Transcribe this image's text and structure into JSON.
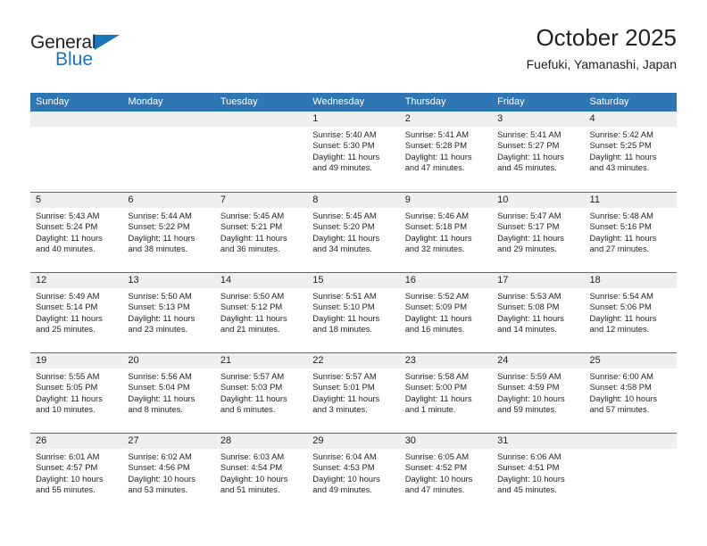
{
  "brand": {
    "name_part1": "General",
    "name_part2": "Blue",
    "accent_color": "#1b75bb"
  },
  "header": {
    "title": "October 2025",
    "location": "Fuefuki, Yamanashi, Japan"
  },
  "theme": {
    "header_row_bg": "#2f76b5",
    "day_band_bg": "#efefef",
    "grid_line": "#2f76b5",
    "text": "#231f20"
  },
  "weekday_headers": [
    "Sunday",
    "Monday",
    "Tuesday",
    "Wednesday",
    "Thursday",
    "Friday",
    "Saturday"
  ],
  "weeks": [
    [
      {
        "day": "",
        "blank": true,
        "sunrise": "",
        "sunset": "",
        "daylight_line1": "",
        "daylight_line2": ""
      },
      {
        "day": "",
        "blank": true,
        "sunrise": "",
        "sunset": "",
        "daylight_line1": "",
        "daylight_line2": ""
      },
      {
        "day": "",
        "blank": true,
        "sunrise": "",
        "sunset": "",
        "daylight_line1": "",
        "daylight_line2": ""
      },
      {
        "day": "1",
        "blank": false,
        "sunrise": "Sunrise: 5:40 AM",
        "sunset": "Sunset: 5:30 PM",
        "daylight_line1": "Daylight: 11 hours",
        "daylight_line2": "and 49 minutes."
      },
      {
        "day": "2",
        "blank": false,
        "sunrise": "Sunrise: 5:41 AM",
        "sunset": "Sunset: 5:28 PM",
        "daylight_line1": "Daylight: 11 hours",
        "daylight_line2": "and 47 minutes."
      },
      {
        "day": "3",
        "blank": false,
        "sunrise": "Sunrise: 5:41 AM",
        "sunset": "Sunset: 5:27 PM",
        "daylight_line1": "Daylight: 11 hours",
        "daylight_line2": "and 45 minutes."
      },
      {
        "day": "4",
        "blank": false,
        "sunrise": "Sunrise: 5:42 AM",
        "sunset": "Sunset: 5:25 PM",
        "daylight_line1": "Daylight: 11 hours",
        "daylight_line2": "and 43 minutes."
      }
    ],
    [
      {
        "day": "5",
        "blank": false,
        "sunrise": "Sunrise: 5:43 AM",
        "sunset": "Sunset: 5:24 PM",
        "daylight_line1": "Daylight: 11 hours",
        "daylight_line2": "and 40 minutes."
      },
      {
        "day": "6",
        "blank": false,
        "sunrise": "Sunrise: 5:44 AM",
        "sunset": "Sunset: 5:22 PM",
        "daylight_line1": "Daylight: 11 hours",
        "daylight_line2": "and 38 minutes."
      },
      {
        "day": "7",
        "blank": false,
        "sunrise": "Sunrise: 5:45 AM",
        "sunset": "Sunset: 5:21 PM",
        "daylight_line1": "Daylight: 11 hours",
        "daylight_line2": "and 36 minutes."
      },
      {
        "day": "8",
        "blank": false,
        "sunrise": "Sunrise: 5:45 AM",
        "sunset": "Sunset: 5:20 PM",
        "daylight_line1": "Daylight: 11 hours",
        "daylight_line2": "and 34 minutes."
      },
      {
        "day": "9",
        "blank": false,
        "sunrise": "Sunrise: 5:46 AM",
        "sunset": "Sunset: 5:18 PM",
        "daylight_line1": "Daylight: 11 hours",
        "daylight_line2": "and 32 minutes."
      },
      {
        "day": "10",
        "blank": false,
        "sunrise": "Sunrise: 5:47 AM",
        "sunset": "Sunset: 5:17 PM",
        "daylight_line1": "Daylight: 11 hours",
        "daylight_line2": "and 29 minutes."
      },
      {
        "day": "11",
        "blank": false,
        "sunrise": "Sunrise: 5:48 AM",
        "sunset": "Sunset: 5:16 PM",
        "daylight_line1": "Daylight: 11 hours",
        "daylight_line2": "and 27 minutes."
      }
    ],
    [
      {
        "day": "12",
        "blank": false,
        "sunrise": "Sunrise: 5:49 AM",
        "sunset": "Sunset: 5:14 PM",
        "daylight_line1": "Daylight: 11 hours",
        "daylight_line2": "and 25 minutes."
      },
      {
        "day": "13",
        "blank": false,
        "sunrise": "Sunrise: 5:50 AM",
        "sunset": "Sunset: 5:13 PM",
        "daylight_line1": "Daylight: 11 hours",
        "daylight_line2": "and 23 minutes."
      },
      {
        "day": "14",
        "blank": false,
        "sunrise": "Sunrise: 5:50 AM",
        "sunset": "Sunset: 5:12 PM",
        "daylight_line1": "Daylight: 11 hours",
        "daylight_line2": "and 21 minutes."
      },
      {
        "day": "15",
        "blank": false,
        "sunrise": "Sunrise: 5:51 AM",
        "sunset": "Sunset: 5:10 PM",
        "daylight_line1": "Daylight: 11 hours",
        "daylight_line2": "and 18 minutes."
      },
      {
        "day": "16",
        "blank": false,
        "sunrise": "Sunrise: 5:52 AM",
        "sunset": "Sunset: 5:09 PM",
        "daylight_line1": "Daylight: 11 hours",
        "daylight_line2": "and 16 minutes."
      },
      {
        "day": "17",
        "blank": false,
        "sunrise": "Sunrise: 5:53 AM",
        "sunset": "Sunset: 5:08 PM",
        "daylight_line1": "Daylight: 11 hours",
        "daylight_line2": "and 14 minutes."
      },
      {
        "day": "18",
        "blank": false,
        "sunrise": "Sunrise: 5:54 AM",
        "sunset": "Sunset: 5:06 PM",
        "daylight_line1": "Daylight: 11 hours",
        "daylight_line2": "and 12 minutes."
      }
    ],
    [
      {
        "day": "19",
        "blank": false,
        "sunrise": "Sunrise: 5:55 AM",
        "sunset": "Sunset: 5:05 PM",
        "daylight_line1": "Daylight: 11 hours",
        "daylight_line2": "and 10 minutes."
      },
      {
        "day": "20",
        "blank": false,
        "sunrise": "Sunrise: 5:56 AM",
        "sunset": "Sunset: 5:04 PM",
        "daylight_line1": "Daylight: 11 hours",
        "daylight_line2": "and 8 minutes."
      },
      {
        "day": "21",
        "blank": false,
        "sunrise": "Sunrise: 5:57 AM",
        "sunset": "Sunset: 5:03 PM",
        "daylight_line1": "Daylight: 11 hours",
        "daylight_line2": "and 6 minutes."
      },
      {
        "day": "22",
        "blank": false,
        "sunrise": "Sunrise: 5:57 AM",
        "sunset": "Sunset: 5:01 PM",
        "daylight_line1": "Daylight: 11 hours",
        "daylight_line2": "and 3 minutes."
      },
      {
        "day": "23",
        "blank": false,
        "sunrise": "Sunrise: 5:58 AM",
        "sunset": "Sunset: 5:00 PM",
        "daylight_line1": "Daylight: 11 hours",
        "daylight_line2": "and 1 minute."
      },
      {
        "day": "24",
        "blank": false,
        "sunrise": "Sunrise: 5:59 AM",
        "sunset": "Sunset: 4:59 PM",
        "daylight_line1": "Daylight: 10 hours",
        "daylight_line2": "and 59 minutes."
      },
      {
        "day": "25",
        "blank": false,
        "sunrise": "Sunrise: 6:00 AM",
        "sunset": "Sunset: 4:58 PM",
        "daylight_line1": "Daylight: 10 hours",
        "daylight_line2": "and 57 minutes."
      }
    ],
    [
      {
        "day": "26",
        "blank": false,
        "sunrise": "Sunrise: 6:01 AM",
        "sunset": "Sunset: 4:57 PM",
        "daylight_line1": "Daylight: 10 hours",
        "daylight_line2": "and 55 minutes."
      },
      {
        "day": "27",
        "blank": false,
        "sunrise": "Sunrise: 6:02 AM",
        "sunset": "Sunset: 4:56 PM",
        "daylight_line1": "Daylight: 10 hours",
        "daylight_line2": "and 53 minutes."
      },
      {
        "day": "28",
        "blank": false,
        "sunrise": "Sunrise: 6:03 AM",
        "sunset": "Sunset: 4:54 PM",
        "daylight_line1": "Daylight: 10 hours",
        "daylight_line2": "and 51 minutes."
      },
      {
        "day": "29",
        "blank": false,
        "sunrise": "Sunrise: 6:04 AM",
        "sunset": "Sunset: 4:53 PM",
        "daylight_line1": "Daylight: 10 hours",
        "daylight_line2": "and 49 minutes."
      },
      {
        "day": "30",
        "blank": false,
        "sunrise": "Sunrise: 6:05 AM",
        "sunset": "Sunset: 4:52 PM",
        "daylight_line1": "Daylight: 10 hours",
        "daylight_line2": "and 47 minutes."
      },
      {
        "day": "31",
        "blank": false,
        "sunrise": "Sunrise: 6:06 AM",
        "sunset": "Sunset: 4:51 PM",
        "daylight_line1": "Daylight: 10 hours",
        "daylight_line2": "and 45 minutes."
      },
      {
        "day": "",
        "blank": true,
        "sunrise": "",
        "sunset": "",
        "daylight_line1": "",
        "daylight_line2": ""
      }
    ]
  ]
}
